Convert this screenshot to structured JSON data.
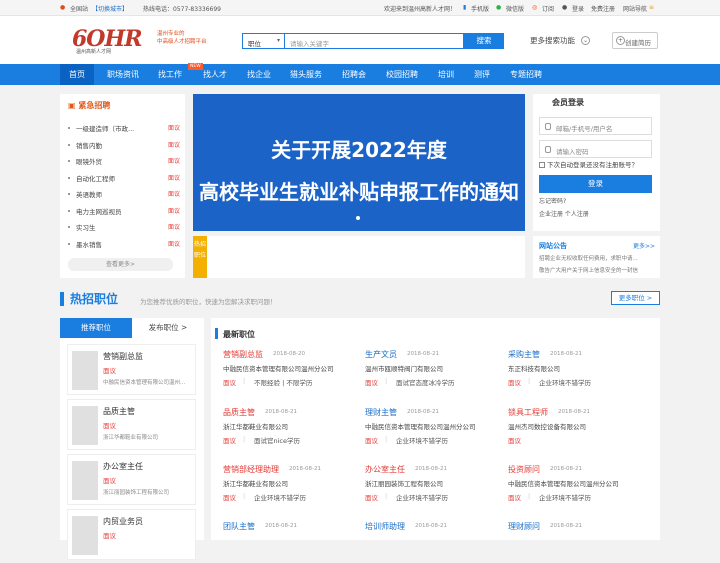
{
  "topbar": {
    "site": "全国站",
    "switch_city": "【切换城市】",
    "hotline": "热线电话：0577-83336699",
    "welcome": "欢迎来到温州高新人才网！",
    "mobile": "手机版",
    "wechat": "微信版",
    "subscribe": "订阅",
    "login": "登录",
    "register": "免费注册",
    "sitemap": "网站导航"
  },
  "header": {
    "logo_text": "6OHR",
    "logo_sub": "温州高新人才网",
    "slogan_line1": "温州专业的",
    "slogan_line2": "中高级人才招聘平台",
    "search_type": "职位",
    "search_placeholder": "请输入关键字",
    "search_button": "搜索",
    "more_search": "更多搜索功能",
    "create_resume": "创建简历"
  },
  "nav": {
    "items": [
      "首页",
      "职场资讯",
      "找工作",
      "找人才",
      "找企业",
      "猎头服务",
      "招聘会",
      "校园招聘",
      "培训",
      "测评",
      "专题招聘"
    ],
    "new_badge": "NEW"
  },
  "urgent": {
    "title": "紧急招聘",
    "items": [
      {
        "title": "一级建造师（市政...",
        "salary": "面议"
      },
      {
        "title": "销售内勤",
        "salary": "面议"
      },
      {
        "title": "眼镜外贸",
        "salary": "面议"
      },
      {
        "title": "自动化工程师",
        "salary": "面议"
      },
      {
        "title": "英语教师",
        "salary": "面议"
      },
      {
        "title": "电力主网巡视员",
        "salary": "面议"
      },
      {
        "title": "实习生",
        "salary": "面议"
      },
      {
        "title": "墨水销售",
        "salary": "面议"
      }
    ],
    "see_more": "查看更多>"
  },
  "banner": {
    "line1": "关于开展2022年度",
    "line2": "高校毕业生就业补贴申报工作的通知"
  },
  "ad_tag": "热招职位",
  "login": {
    "title": "会员登录",
    "user_placeholder": "邮箱/手机号/用户名",
    "pass_placeholder": "请输入密码",
    "remember": "下次自动登录还没有注册账号？",
    "button": "登录",
    "forgot": "忘记密码?",
    "reg_links": "企业注册  个人注册"
  },
  "notice": {
    "title": "网站公告",
    "more": "更多>>",
    "items": [
      "招聘企业无权收取任何费用，求职中请...",
      "敬告广大用户关于网上信息安全的一封信"
    ]
  },
  "hot": {
    "title": "热招职位",
    "subtitle": "为您推荐优质的职位，快速为您解决求职问题！",
    "more": "更多职位 >",
    "tab_recommend": "推荐职位",
    "tab_publish": "发布职位 >"
  },
  "cards": [
    {
      "name": "营销副总监",
      "salary": "面议",
      "company": "中融民信资本管理有限公司温州..."
    },
    {
      "name": "品质主管",
      "salary": "面议",
      "company": "浙江华都鞋业有限公司"
    },
    {
      "name": "办公室主任",
      "salary": "面议",
      "company": "浙江丽园装饰工程有限公司"
    },
    {
      "name": "内贸业务员",
      "salary": "面议",
      "company": ""
    }
  ],
  "latest": {
    "title": "最新职位",
    "jobs": [
      {
        "name": "营销副总监",
        "date": "2018-08-20",
        "company": "中融民信资本管理有限公司温州分公司",
        "salary": "面议",
        "req": "不限经验  |  不限学历",
        "style": "red"
      },
      {
        "name": "生产文员",
        "date": "2018-08-21",
        "company": "温州市瓯顺特阀门有限公司",
        "salary": "面议",
        "req": "面试官态度冰冷学历",
        "style": "blue"
      },
      {
        "name": "采购主管",
        "date": "2018-08-21",
        "company": "东正科技有限公司",
        "salary": "面议",
        "req": "企业环境不错学历",
        "style": "blue"
      },
      {
        "name": "品质主管",
        "date": "2018-08-21",
        "company": "浙江华都鞋业有限公司",
        "salary": "面议",
        "req": "面试官nice学历",
        "style": "red"
      },
      {
        "name": "理财主管",
        "date": "2018-08-21",
        "company": "中融民信资本管理有限公司温州分公司",
        "salary": "面议",
        "req": "企业环境不错学历",
        "style": "blue"
      },
      {
        "name": "锁具工程师",
        "date": "2018-08-21",
        "company": "温州杰司数控设备有限公司",
        "salary": "面议",
        "req": "",
        "style": "red"
      },
      {
        "name": "营销部经理助理",
        "date": "2018-08-21",
        "company": "浙江华都鞋业有限公司",
        "salary": "面议",
        "req": "企业环境不错学历",
        "style": "red"
      },
      {
        "name": "办公室主任",
        "date": "2018-08-21",
        "company": "浙江丽园装饰工程有限公司",
        "salary": "面议",
        "req": "企业环境不错学历",
        "style": "red"
      },
      {
        "name": "投资顾问",
        "date": "2018-08-21",
        "company": "中融民信资本管理有限公司温州分公司",
        "salary": "面议",
        "req": "企业环境不错学历",
        "style": "red"
      },
      {
        "name": "团队主管",
        "date": "2018-08-21",
        "company": "",
        "salary": "",
        "req": "",
        "style": "blue"
      },
      {
        "name": "培训师助理",
        "date": "2018-08-21",
        "company": "",
        "salary": "",
        "req": "",
        "style": "blue"
      },
      {
        "name": "理财顾问",
        "date": "2018-08-21",
        "company": "",
        "salary": "",
        "req": "",
        "style": "blue"
      }
    ]
  }
}
